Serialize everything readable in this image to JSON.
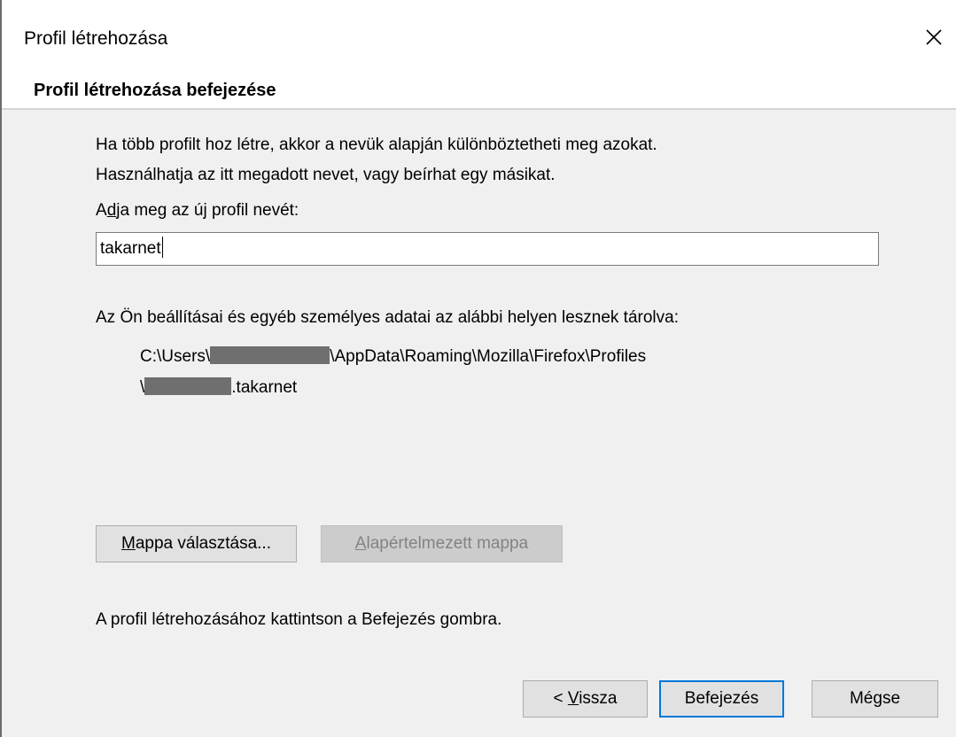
{
  "window": {
    "title": "Profil létrehozása",
    "close_symbol": "close-icon"
  },
  "header": {
    "title": "Profil létrehozása befejezése"
  },
  "body": {
    "intro_line1": "Ha több profilt hoz létre, akkor a nevük alapján különböztetheti meg azokat.",
    "intro_line2": "Használhatja az itt megadott nevet, vagy beírhat egy másikat.",
    "name_label_prefix": "A",
    "name_label_accel": "d",
    "name_label_rest": "ja meg az új profil nevét:",
    "profile_name_value": "takarnet",
    "storage_label": "Az Ön beállításai és egyéb személyes adatai az alábbi helyen lesznek tárolva:",
    "path_line1_prefix": "C:\\Users\\",
    "path_line1_suffix": "\\AppData\\Roaming\\Mozilla\\Firefox\\Profiles",
    "path_line2_prefix": "\\",
    "path_line2_suffix": ".takarnet",
    "finish_hint": "A profil létrehozásához kattintson a Befejezés gombra."
  },
  "buttons": {
    "choose_folder_accel": "M",
    "choose_folder_rest": "appa választása...",
    "default_folder_accel": "A",
    "default_folder_rest": "lapértelmezett mappa",
    "back_prefix": "< ",
    "back_accel": "V",
    "back_rest": "issza",
    "finish": "Befejezés",
    "cancel": "Mégse"
  },
  "colors": {
    "panel_background": "#f0f0f0",
    "default_button_border": "#0078d7",
    "redaction": "#6f6f6f"
  }
}
